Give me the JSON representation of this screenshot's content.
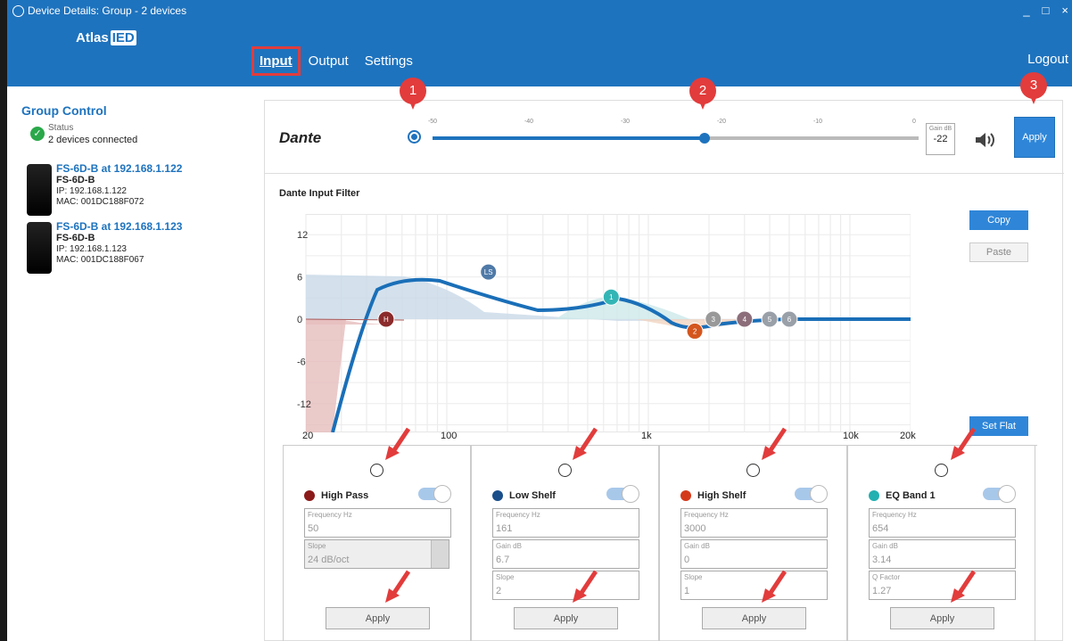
{
  "window": {
    "title": "Device Details: Group - 2 devices",
    "controls": [
      "_",
      "□",
      "×"
    ]
  },
  "nav": {
    "logo_prefix": "Atlas",
    "logo_ied": "IED",
    "tabs": [
      {
        "label": "Input",
        "active": true
      },
      {
        "label": "Output"
      },
      {
        "label": "Settings"
      }
    ],
    "logout": "Logout"
  },
  "sidebar": {
    "group_title": "Group Control",
    "status_label": "Status",
    "status_value": "2 devices connected",
    "devices": [
      {
        "name": "FS-6D-B at 192.168.1.122",
        "model": "FS-6D-B",
        "ip": "IP: 192.168.1.122",
        "mac": "MAC: 001DC188F072"
      },
      {
        "name": "FS-6D-B at 192.168.1.123",
        "model": "FS-6D-B",
        "ip": "IP: 192.168.1.123",
        "mac": "MAC: 001DC188F067"
      }
    ]
  },
  "dante": {
    "logo": "Dante",
    "slider_ticks": [
      "-50",
      "-40",
      "-30",
      "-20",
      "-10",
      "0"
    ],
    "gain_label": "Gain dB",
    "gain_value": "-22",
    "slider_value_db": -22,
    "slider_min": -50,
    "slider_max": 0,
    "apply_label": "Apply"
  },
  "filter": {
    "title": "Dante Input Filter",
    "copy_label": "Copy",
    "paste_label": "Paste",
    "setflat_label": "Set Flat",
    "y_ticks": [
      "12",
      "6",
      "0",
      "-6",
      "-12"
    ],
    "x_ticks": [
      "20",
      "100",
      "1k",
      "10k",
      "20k"
    ],
    "markers": [
      {
        "label": "H",
        "color": "#8b2b2b"
      },
      {
        "label": "LS",
        "color": "#4f7aa8"
      },
      {
        "label": "1",
        "color": "#33b5b5"
      },
      {
        "label": "2",
        "color": "#d4561e"
      },
      {
        "label": "3",
        "color": "#999999"
      },
      {
        "label": "4",
        "color": "#8c6e7a"
      },
      {
        "label": "5",
        "color": "#9aa0a8"
      },
      {
        "label": "6",
        "color": "#9aa0a8"
      }
    ]
  },
  "bands": [
    {
      "title": "High Pass",
      "color": "#8b1a1a",
      "fields": [
        {
          "label": "Frequency Hz",
          "value": "50"
        },
        {
          "label": "Slope",
          "value": "24 dB/oct"
        }
      ],
      "apply": "Apply"
    },
    {
      "title": "Low Shelf",
      "color": "#1a4e8a",
      "fields": [
        {
          "label": "Frequency Hz",
          "value": "161"
        },
        {
          "label": "Gain dB",
          "value": "6.7"
        },
        {
          "label": "Slope",
          "value": "2"
        }
      ],
      "apply": "Apply"
    },
    {
      "title": "High Shelf",
      "color": "#d43a1a",
      "fields": [
        {
          "label": "Frequency Hz",
          "value": "3000"
        },
        {
          "label": "Gain dB",
          "value": "0"
        },
        {
          "label": "Slope",
          "value": "1"
        }
      ],
      "apply": "Apply"
    },
    {
      "title": "EQ Band 1",
      "color": "#22b0b0",
      "fields": [
        {
          "label": "Frequency Hz",
          "value": "654"
        },
        {
          "label": "Gain dB",
          "value": "3.14"
        },
        {
          "label": "Q Factor",
          "value": "1.27"
        }
      ],
      "apply": "Apply"
    }
  ],
  "callouts": [
    "1",
    "2",
    "3"
  ]
}
